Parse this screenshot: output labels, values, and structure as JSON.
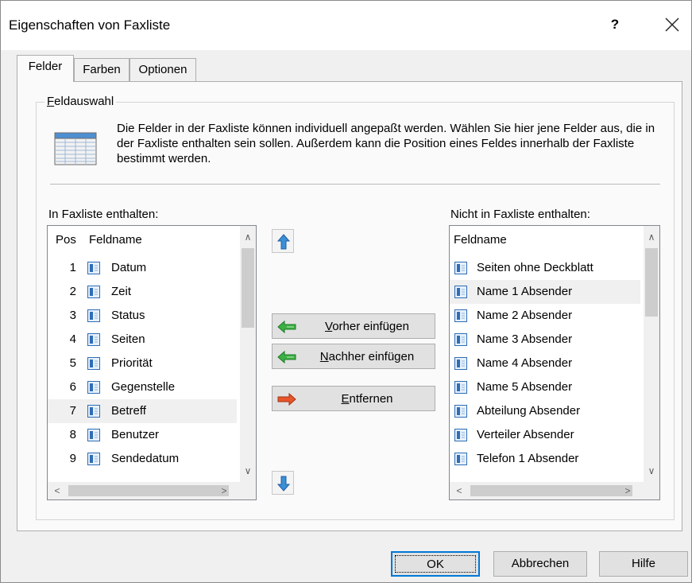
{
  "window": {
    "title": "Eigenschaften von Faxliste",
    "help_label": "?",
    "close_icon": "close-icon"
  },
  "tabs": [
    {
      "label": "Felder",
      "active": true
    },
    {
      "label": "Farben",
      "active": false
    },
    {
      "label": "Optionen",
      "active": false
    }
  ],
  "group": {
    "label_first": "F",
    "label_rest": "eldauswahl",
    "description": "Die Felder in der Faxliste können individuell angepaßt werden. Wählen Sie hier jene Felder aus, die in der Faxliste enthalten sein sollen. Außerdem kann die Position eines Feldes innerhalb der Faxliste bestimmt werden."
  },
  "included": {
    "label": "In Faxliste enthalten:",
    "col_pos": "Pos",
    "col_name": "Feldname",
    "selected_index": 6,
    "rows": [
      {
        "pos": "1",
        "name": "Datum"
      },
      {
        "pos": "2",
        "name": "Zeit"
      },
      {
        "pos": "3",
        "name": "Status"
      },
      {
        "pos": "4",
        "name": "Seiten"
      },
      {
        "pos": "5",
        "name": "Priorität"
      },
      {
        "pos": "6",
        "name": "Gegenstelle"
      },
      {
        "pos": "7",
        "name": "Betreff"
      },
      {
        "pos": "8",
        "name": "Benutzer"
      },
      {
        "pos": "9",
        "name": "Sendedatum"
      }
    ]
  },
  "excluded": {
    "label": "Nicht in Faxliste enthalten:",
    "col_name": "Feldname",
    "selected_index": 1,
    "rows": [
      "Seiten ohne Deckblatt",
      "Name 1 Absender",
      "Name 2 Absender",
      "Name 3 Absender",
      "Name 4 Absender",
      "Name 5 Absender",
      "Abteilung Absender",
      "Verteiler Absender",
      "Telefon 1 Absender"
    ]
  },
  "actions": {
    "insert_before": "Vorher einfügen",
    "insert_after": "Nachher einfügen",
    "remove": "Entfernen"
  },
  "footer": {
    "ok": "OK",
    "cancel": "Abbrechen",
    "help": "Hilfe"
  },
  "colors": {
    "window_bg": "#f0f0f0",
    "panel_bg": "#fafafa",
    "selection": "#f0f0f0",
    "accent": "#0078d7",
    "arrow_blue": "#3a8fd6",
    "arrow_green": "#3cb043",
    "arrow_red": "#e8552a"
  }
}
